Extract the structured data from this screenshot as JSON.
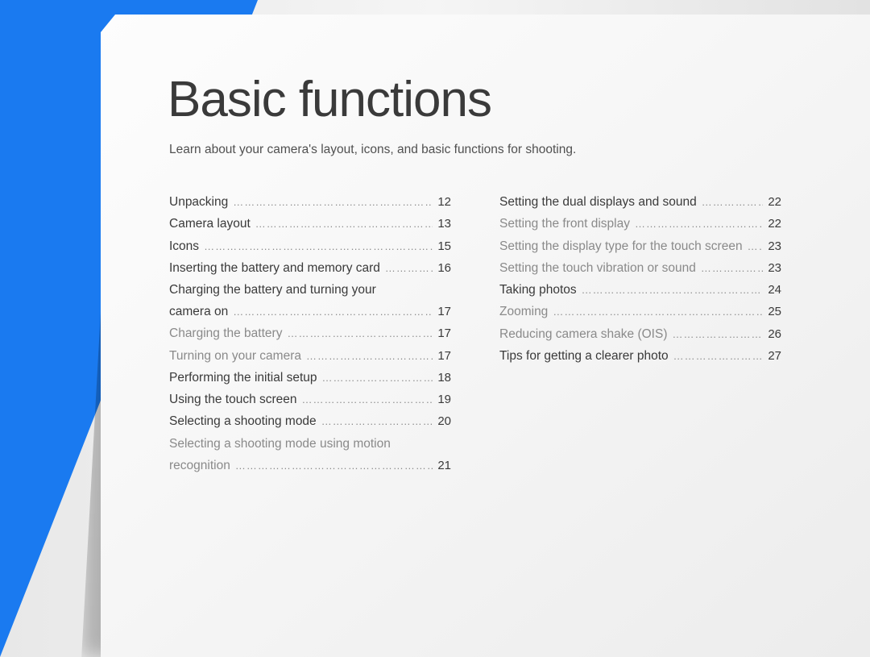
{
  "title": "Basic functions",
  "subtitle": "Learn about your camera's layout, icons, and basic functions for shooting.",
  "col1": [
    {
      "label": "Unpacking",
      "page": "12",
      "level": "top",
      "wrap": false
    },
    {
      "label": "Camera layout",
      "page": "13",
      "level": "top",
      "wrap": false
    },
    {
      "label": "Icons",
      "page": "15",
      "level": "top",
      "wrap": false
    },
    {
      "label": "Inserting the battery and memory card",
      "page": "16",
      "level": "top",
      "wrap": false
    },
    {
      "label_line1": "Charging the battery and turning your",
      "label_line2": "camera on",
      "page": "17",
      "level": "top",
      "wrap": true
    },
    {
      "label": "Charging the battery",
      "page": "17",
      "level": "sub",
      "wrap": false
    },
    {
      "label": "Turning on your camera",
      "page": "17",
      "level": "sub",
      "wrap": false
    },
    {
      "label": "Performing the initial setup",
      "page": "18",
      "level": "top",
      "wrap": false
    },
    {
      "label": "Using the touch screen",
      "page": "19",
      "level": "top",
      "wrap": false
    },
    {
      "label": "Selecting a shooting mode",
      "page": "20",
      "level": "top",
      "wrap": false
    },
    {
      "label_line1": "Selecting a shooting mode using motion",
      "label_line2": "recognition",
      "page": "21",
      "level": "sub",
      "wrap": true
    }
  ],
  "col2": [
    {
      "label": "Setting the dual displays and sound",
      "page": "22",
      "level": "top",
      "wrap": false
    },
    {
      "label": "Setting the front display",
      "page": "22",
      "level": "sub",
      "wrap": false
    },
    {
      "label": "Setting the display type for the touch screen",
      "page": "23",
      "level": "sub",
      "wrap": false
    },
    {
      "label": "Setting the touch vibration or sound",
      "page": "23",
      "level": "sub",
      "wrap": false
    },
    {
      "label": "Taking photos",
      "page": "24",
      "level": "top",
      "wrap": false
    },
    {
      "label": "Zooming",
      "page": "25",
      "level": "sub",
      "wrap": false
    },
    {
      "label": "Reducing camera shake (OIS)",
      "page": "26",
      "level": "sub",
      "wrap": false
    },
    {
      "label": "Tips for getting a clearer photo",
      "page": "27",
      "level": "top",
      "wrap": false
    }
  ]
}
